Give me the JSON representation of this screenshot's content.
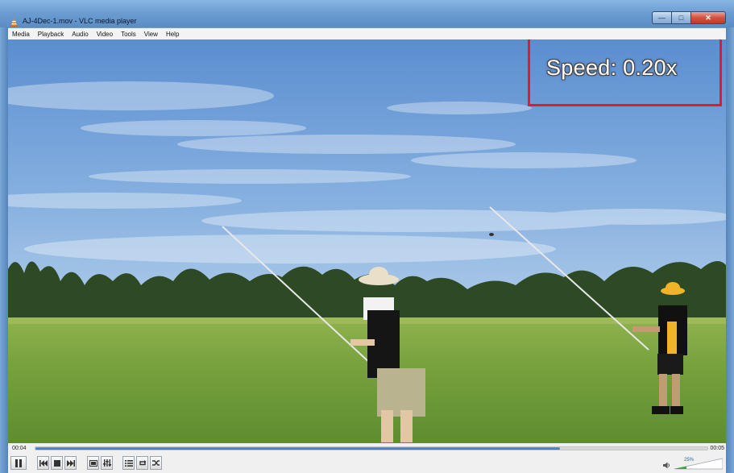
{
  "window": {
    "title": "AJ-4Dec-1.mov - VLC media player",
    "icon": "vlc-cone-icon"
  },
  "menu": [
    "Media",
    "Playback",
    "Audio",
    "Video",
    "Tools",
    "View",
    "Help"
  ],
  "overlay": {
    "speed_text": "Speed: 0.20x",
    "highlight_color": "#e31b23"
  },
  "player": {
    "elapsed": "00:04",
    "total": "00:05",
    "progress_fraction": 0.78,
    "volume_label": "25%",
    "volume_fraction": 0.25
  },
  "colors": {
    "accent": "#2d73c4",
    "sky": "#6f9fd4",
    "grass": "#6c9a3a"
  }
}
